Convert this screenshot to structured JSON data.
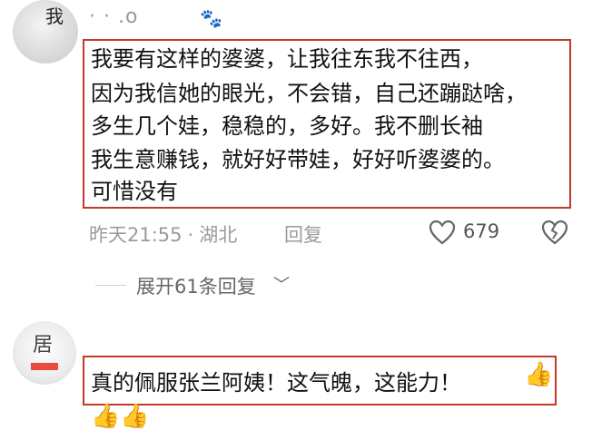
{
  "comments": [
    {
      "username": "·    ·  .o",
      "avatar_text": "我",
      "paw_icon": "paw-icon",
      "lines": [
        "我要有这样的婆婆，让我往东我不往西，",
        "因为我信她的眼光，不会错，自己还蹦跶啥，",
        "多生几个娃，稳稳的，多好。我不删长袖",
        "我生意赚钱，就好好带娃，好好听婆婆的。",
        "可惜没有"
      ],
      "time": "昨天21:55",
      "location": "湖北",
      "reply_label": "回复",
      "likes": "679",
      "expand_label": "展开61条回复"
    },
    {
      "avatar_text": "居",
      "text": "真的佩服张兰阿姨！这气魄，这能力！"
    }
  ],
  "colors": {
    "highlight_border": "#c0392b",
    "meta": "#9b9b9b"
  }
}
